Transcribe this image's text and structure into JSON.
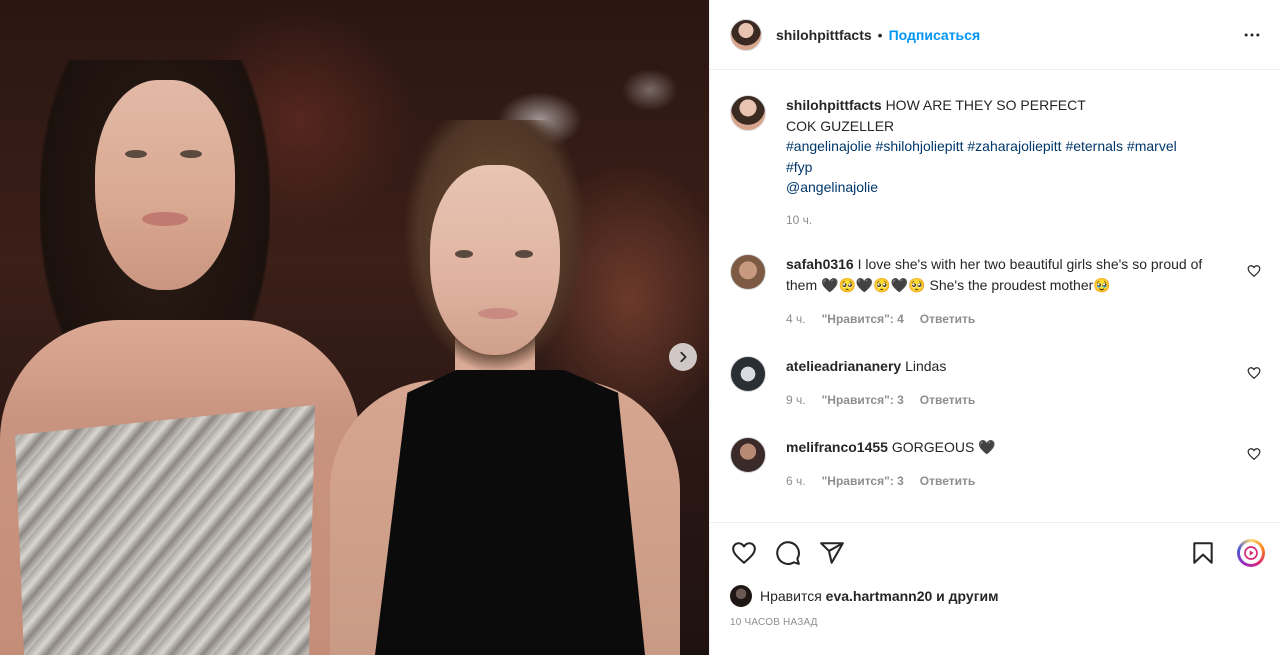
{
  "post": {
    "username": "shilohpittfacts",
    "follow_label": "Подписаться",
    "separator": "•"
  },
  "caption": {
    "username": "shilohpittfacts",
    "line1": "HOW ARE THEY SO PERFECT",
    "line2": "COK GUZELLER",
    "hashtags_line1": [
      "#angelinajolie",
      "#shilohjoliepitt",
      "#zaharajoliepitt",
      "#eternals",
      "#marvel"
    ],
    "hashtags_line2": [
      "#fyp"
    ],
    "mention": "@angelinajolie",
    "time": "10 ч."
  },
  "comments": [
    {
      "username": "safah0316",
      "text": "I love she's with her two beautiful girls she's so proud of them 🖤🥺🖤🥺🖤🥺 She's the proudest mother🥹",
      "time": "4 ч.",
      "likes": "\"Нравится\": 4",
      "reply": "Ответить"
    },
    {
      "username": "atelieadriananery",
      "text": "Lindas",
      "time": "9 ч.",
      "likes": "\"Нравится\": 3",
      "reply": "Ответить"
    },
    {
      "username": "melifranco1455",
      "text": "GORGEOUS 🖤",
      "time": "6 ч.",
      "likes": "\"Нравится\": 3",
      "reply": "Ответить"
    }
  ],
  "likes": {
    "prefix": "Нравится",
    "user": "eva.hartmann20",
    "suffix": "и другим"
  },
  "posted_ago": "10 ЧАСОВ НАЗАД",
  "icons": {
    "like": "heart-icon",
    "comment": "comment-icon",
    "share": "share-icon",
    "save": "bookmark-icon",
    "reel": "reel-icon",
    "more": "more-icon",
    "next": "chevron-right-icon"
  }
}
